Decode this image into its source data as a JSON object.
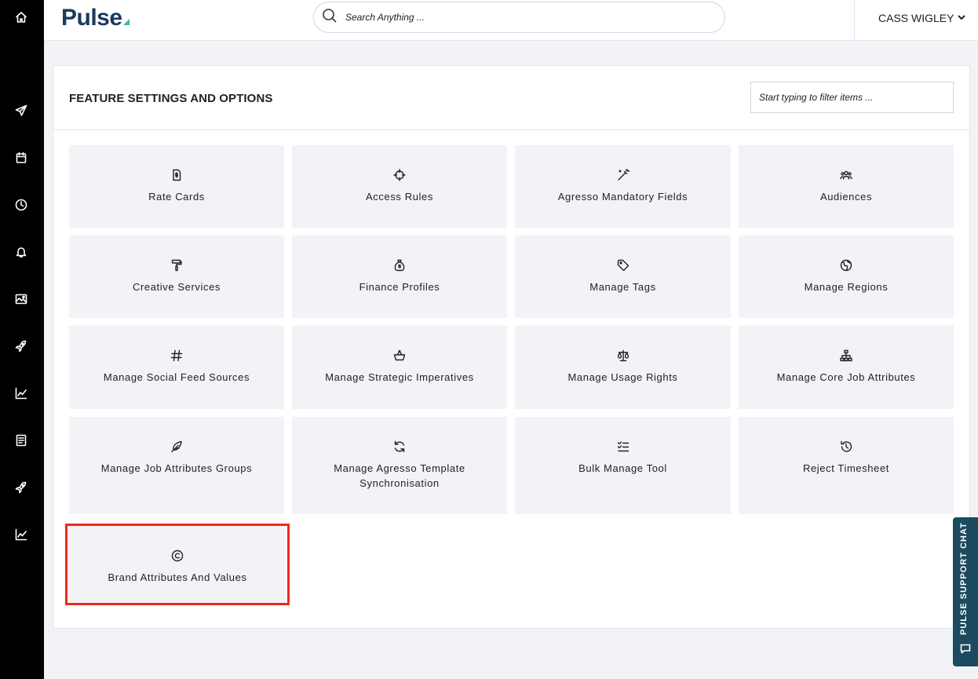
{
  "app": {
    "logo_text": "Pulse"
  },
  "search": {
    "placeholder": "Search Anything ..."
  },
  "user": {
    "name": "CASS WIGLEY"
  },
  "sidebar": {
    "items": [
      {
        "icon": "home-icon"
      },
      {
        "icon": "send-icon"
      },
      {
        "icon": "calendar-icon"
      },
      {
        "icon": "clock-icon"
      },
      {
        "icon": "bell-icon"
      },
      {
        "icon": "image-icon"
      },
      {
        "icon": "rocket-icon"
      },
      {
        "icon": "trend-chart-icon"
      },
      {
        "icon": "book-icon"
      },
      {
        "icon": "rocket-icon"
      },
      {
        "icon": "trend-chart-icon"
      }
    ]
  },
  "panel": {
    "title": "FEATURE SETTINGS AND OPTIONS",
    "filter_placeholder": "Start typing to filter items ...",
    "tiles": [
      {
        "label": "Rate Cards",
        "icon": "rate-card-icon"
      },
      {
        "label": "Access Rules",
        "icon": "crosshair-icon"
      },
      {
        "label": "Agresso Mandatory Fields",
        "icon": "magic-wand-icon"
      },
      {
        "label": "Audiences",
        "icon": "people-icon"
      },
      {
        "label": "Creative Services",
        "icon": "paint-roller-icon"
      },
      {
        "label": "Finance Profiles",
        "icon": "money-bag-icon"
      },
      {
        "label": "Manage Tags",
        "icon": "tag-icon"
      },
      {
        "label": "Manage Regions",
        "icon": "globe-icon"
      },
      {
        "label": "Manage Social Feed Sources",
        "icon": "hashtag-icon"
      },
      {
        "label": "Manage Strategic Imperatives",
        "icon": "basket-icon"
      },
      {
        "label": "Manage Usage Rights",
        "icon": "scale-icon"
      },
      {
        "label": "Manage Core Job Attributes",
        "icon": "hierarchy-icon"
      },
      {
        "label": "Manage Job Attributes Groups",
        "icon": "feather-icon"
      },
      {
        "label": "Manage Agresso Template Synchronisation",
        "icon": "sync-icon"
      },
      {
        "label": "Bulk Manage Tool",
        "icon": "checklist-icon"
      },
      {
        "label": "Reject Timesheet",
        "icon": "history-icon"
      },
      {
        "label": "Brand Attributes And Values",
        "icon": "copyright-icon"
      }
    ]
  },
  "chat": {
    "label": "PULSE SUPPORT CHAT",
    "icon": "chat-bubble-icon"
  },
  "colors": {
    "sidebar": "#000000",
    "logo": "#1a3a5c",
    "logo_accent": "#3fb79a",
    "tile_bg": "#f2f2f7",
    "highlight": "#ee2a1b",
    "chat_tab": "#1c4a5e"
  }
}
